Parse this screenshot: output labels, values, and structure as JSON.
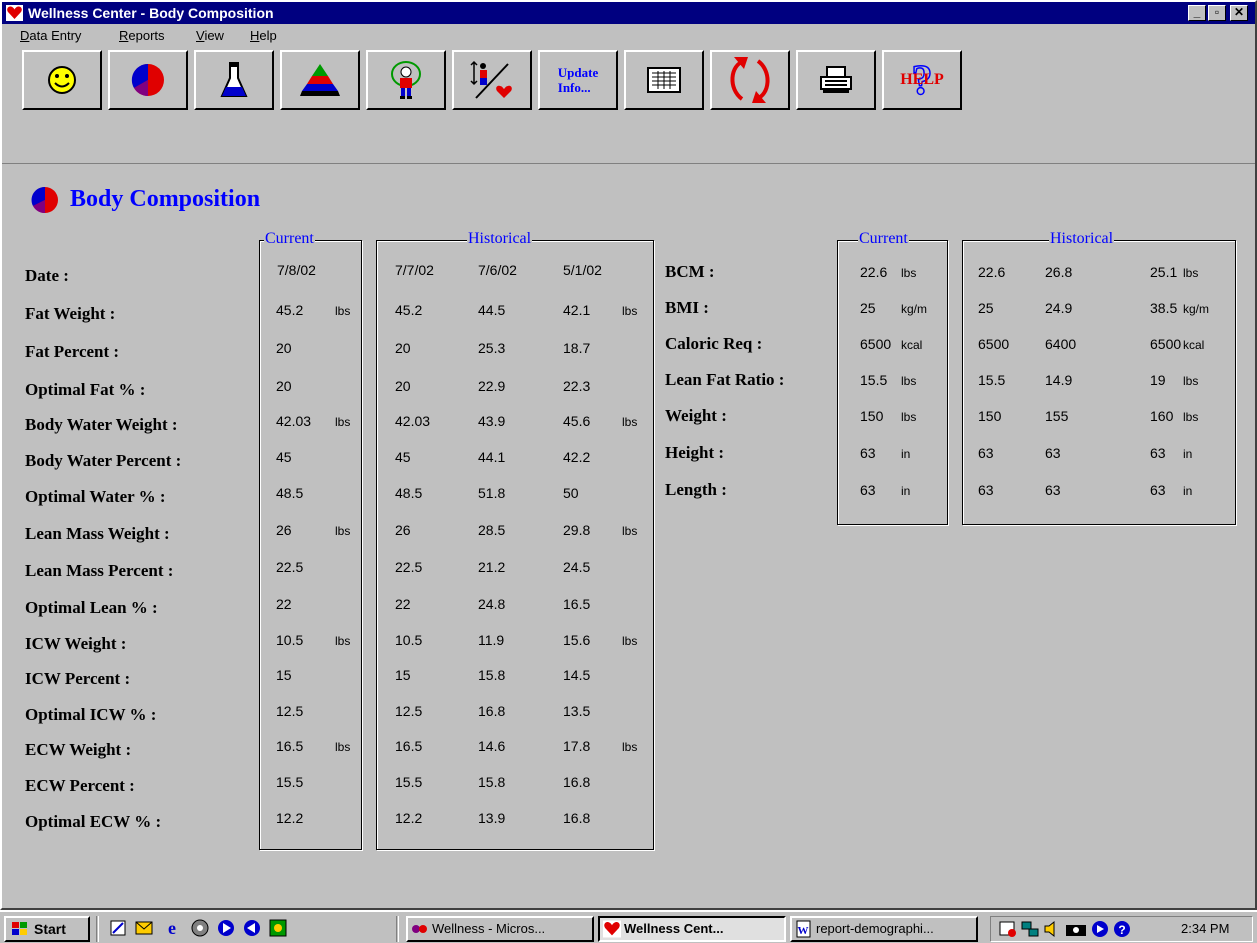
{
  "window": {
    "title": "Wellness Center - Body Composition",
    "minimize": "_",
    "maximize": "▫",
    "close": "✕"
  },
  "menu": {
    "items": [
      {
        "underline": "D",
        "rest": "ata Entry"
      },
      {
        "underline": "R",
        "rest": "eports"
      },
      {
        "underline": "V",
        "rest": "iew"
      },
      {
        "underline": "H",
        "rest": "elp"
      }
    ]
  },
  "toolbar": {
    "buttons": [
      {
        "icon": "smiley-icon"
      },
      {
        "icon": "pie-chart-icon"
      },
      {
        "icon": "flask-icon"
      },
      {
        "icon": "food-pyramid-icon"
      },
      {
        "icon": "jump-rope-icon"
      },
      {
        "icon": "height-heart-icon"
      },
      {
        "icon": "update-info",
        "label_line1": "Update",
        "label_line2": "Info..."
      },
      {
        "icon": "grid-report-icon"
      },
      {
        "icon": "refresh-icon"
      },
      {
        "icon": "printer-icon"
      },
      {
        "icon": "help-icon",
        "label": "HELP"
      }
    ]
  },
  "page": {
    "title": "Body Composition",
    "current_legend": "Current",
    "historical_legend": "Historical"
  },
  "left_table": {
    "dates": {
      "current": "7/8/02",
      "historical": [
        "7/7/02",
        "7/6/02",
        "5/1/02"
      ]
    },
    "rows": [
      {
        "label": "Date :"
      },
      {
        "label": "Fat Weight :",
        "current": "45.2",
        "hist": [
          "45.2",
          "44.5",
          "42.1"
        ],
        "unit": "lbs"
      },
      {
        "label": "Fat Percent :",
        "current": "20",
        "hist": [
          "20",
          "25.3",
          "18.7"
        ],
        "unit": ""
      },
      {
        "label": "Optimal Fat % :",
        "current": "20",
        "hist": [
          "20",
          "22.9",
          "22.3"
        ],
        "unit": ""
      },
      {
        "label": "Body Water Weight :",
        "current": "42.03",
        "hist": [
          "42.03",
          "43.9",
          "45.6"
        ],
        "unit": "lbs"
      },
      {
        "label": "Body Water Percent :",
        "current": "45",
        "hist": [
          "45",
          "44.1",
          "42.2"
        ],
        "unit": ""
      },
      {
        "label": "Optimal Water % :",
        "current": "48.5",
        "hist": [
          "48.5",
          "51.8",
          "50"
        ],
        "unit": ""
      },
      {
        "label": "Lean Mass Weight :",
        "current": "26",
        "hist": [
          "26",
          "28.5",
          "29.8"
        ],
        "unit": "lbs"
      },
      {
        "label": "Lean Mass Percent :",
        "current": "22.5",
        "hist": [
          "22.5",
          "21.2",
          "24.5"
        ],
        "unit": ""
      },
      {
        "label": "Optimal Lean % :",
        "current": "22",
        "hist": [
          "22",
          "24.8",
          "16.5"
        ],
        "unit": ""
      },
      {
        "label": "ICW Weight :",
        "current": "10.5",
        "hist": [
          "10.5",
          "11.9",
          "15.6"
        ],
        "unit": "lbs"
      },
      {
        "label": "ICW Percent :",
        "current": "15",
        "hist": [
          "15",
          "15.8",
          "14.5"
        ],
        "unit": ""
      },
      {
        "label": "Optimal ICW % :",
        "current": "12.5",
        "hist": [
          "12.5",
          "16.8",
          "13.5"
        ],
        "unit": ""
      },
      {
        "label": "ECW Weight :",
        "current": "16.5",
        "hist": [
          "16.5",
          "14.6",
          "17.8"
        ],
        "unit": "lbs"
      },
      {
        "label": "ECW Percent :",
        "current": "15.5",
        "hist": [
          "15.5",
          "15.8",
          "16.8"
        ],
        "unit": ""
      },
      {
        "label": "Optimal ECW % :",
        "current": "12.2",
        "hist": [
          "12.2",
          "13.9",
          "16.8"
        ],
        "unit": ""
      }
    ]
  },
  "right_table": {
    "rows": [
      {
        "label": "BCM :",
        "current": "22.6",
        "unit": "lbs",
        "hist": [
          "22.6",
          "26.8",
          "25.1"
        ],
        "hist_unit": "lbs"
      },
      {
        "label": "BMI :",
        "current": "25",
        "unit": "kg/m",
        "hist": [
          "25",
          "24.9",
          "38.5"
        ],
        "hist_unit": "kg/m"
      },
      {
        "label": "Caloric Req :",
        "current": "6500",
        "unit": "kcal",
        "hist": [
          "6500",
          "6400",
          "6500"
        ],
        "hist_unit": "kcal"
      },
      {
        "label": "Lean Fat Ratio :",
        "current": "15.5",
        "unit": "lbs",
        "hist": [
          "15.5",
          "14.9",
          "19"
        ],
        "hist_unit": "lbs"
      },
      {
        "label": "Weight :",
        "current": "150",
        "unit": "lbs",
        "hist": [
          "150",
          "155",
          "160"
        ],
        "hist_unit": "lbs"
      },
      {
        "label": "Height :",
        "current": "63",
        "unit": "in",
        "hist": [
          "63",
          "63",
          "63"
        ],
        "hist_unit": "in"
      },
      {
        "label": "Length :",
        "current": "63",
        "unit": "in",
        "hist": [
          "63",
          "63",
          "63"
        ],
        "hist_unit": "in"
      }
    ]
  },
  "taskbar": {
    "start": "Start",
    "tasks": [
      {
        "label": "Wellness - Micros..."
      },
      {
        "label": "Wellness Cent..."
      },
      {
        "label": "report-demographi..."
      }
    ],
    "clock": "2:34 PM"
  }
}
